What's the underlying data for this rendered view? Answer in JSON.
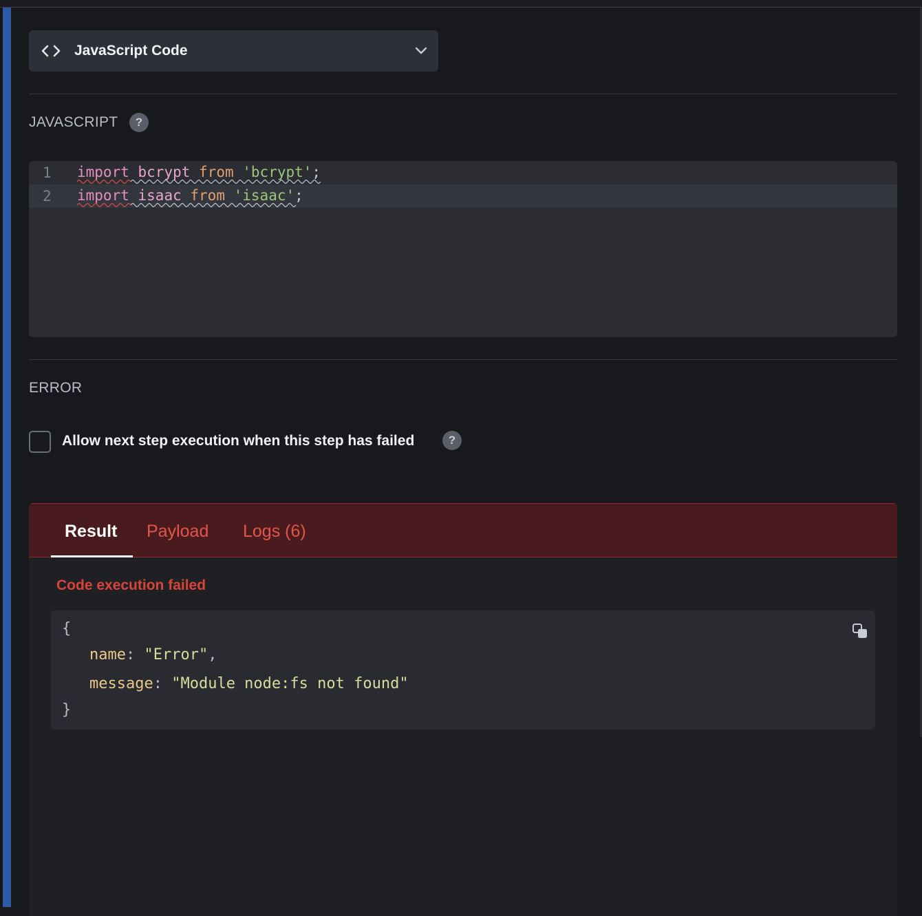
{
  "step_selector": {
    "label": "JavaScript Code",
    "icon": "code-brackets-icon"
  },
  "javascript_section": {
    "title": "JAVASCRIPT",
    "help": "?"
  },
  "editor": {
    "lines": [
      {
        "number": "1",
        "keyword": "import",
        "identifier": "bcrypt",
        "from": "from",
        "string": "'bcrypt'",
        "end": ";"
      },
      {
        "number": "2",
        "keyword": "import",
        "identifier": "isaac",
        "from": "from",
        "string": "'isaac'",
        "end": ";"
      }
    ]
  },
  "error_section": {
    "title": "ERROR",
    "checkbox_label": "Allow next step execution when this step has failed",
    "checkbox_checked": false,
    "help": "?"
  },
  "result_panel": {
    "tabs": [
      {
        "label": "Result",
        "active": true
      },
      {
        "label": "Payload",
        "active": false
      },
      {
        "label": "Logs (6)",
        "active": false
      }
    ],
    "error_title": "Code execution failed",
    "json": {
      "open": "{",
      "close": "}",
      "fields": [
        {
          "key": "name",
          "value": "\"Error\"",
          "trail": ","
        },
        {
          "key": "message",
          "value": "\"Module node:fs not found\"",
          "trail": ""
        }
      ]
    }
  },
  "colors": {
    "accent_bar": "#2d5aa6",
    "tab_bar_bg": "#4a1b1e",
    "error_red": "#d8443a"
  }
}
